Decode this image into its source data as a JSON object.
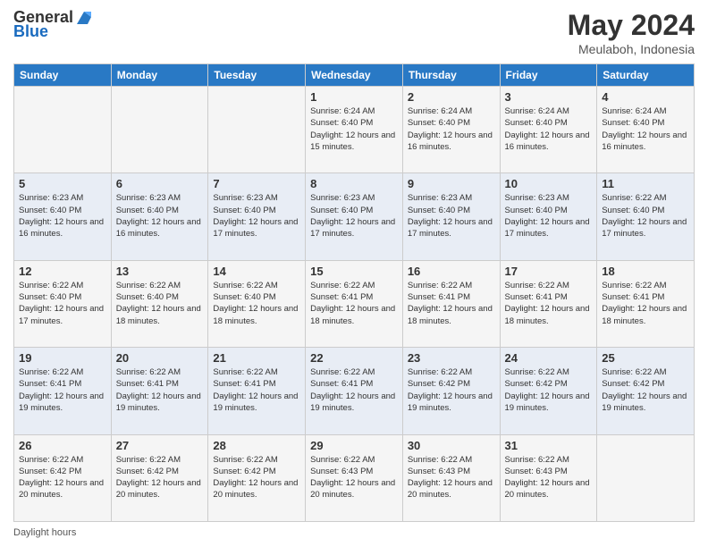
{
  "logo": {
    "general": "General",
    "blue": "Blue"
  },
  "title": "May 2024",
  "subtitle": "Meulaboh, Indonesia",
  "days_of_week": [
    "Sunday",
    "Monday",
    "Tuesday",
    "Wednesday",
    "Thursday",
    "Friday",
    "Saturday"
  ],
  "weeks": [
    [
      {
        "day": "",
        "info": ""
      },
      {
        "day": "",
        "info": ""
      },
      {
        "day": "",
        "info": ""
      },
      {
        "day": "1",
        "info": "Sunrise: 6:24 AM\nSunset: 6:40 PM\nDaylight: 12 hours\nand 15 minutes."
      },
      {
        "day": "2",
        "info": "Sunrise: 6:24 AM\nSunset: 6:40 PM\nDaylight: 12 hours\nand 16 minutes."
      },
      {
        "day": "3",
        "info": "Sunrise: 6:24 AM\nSunset: 6:40 PM\nDaylight: 12 hours\nand 16 minutes."
      },
      {
        "day": "4",
        "info": "Sunrise: 6:24 AM\nSunset: 6:40 PM\nDaylight: 12 hours\nand 16 minutes."
      }
    ],
    [
      {
        "day": "5",
        "info": "Sunrise: 6:23 AM\nSunset: 6:40 PM\nDaylight: 12 hours\nand 16 minutes."
      },
      {
        "day": "6",
        "info": "Sunrise: 6:23 AM\nSunset: 6:40 PM\nDaylight: 12 hours\nand 16 minutes."
      },
      {
        "day": "7",
        "info": "Sunrise: 6:23 AM\nSunset: 6:40 PM\nDaylight: 12 hours\nand 17 minutes."
      },
      {
        "day": "8",
        "info": "Sunrise: 6:23 AM\nSunset: 6:40 PM\nDaylight: 12 hours\nand 17 minutes."
      },
      {
        "day": "9",
        "info": "Sunrise: 6:23 AM\nSunset: 6:40 PM\nDaylight: 12 hours\nand 17 minutes."
      },
      {
        "day": "10",
        "info": "Sunrise: 6:23 AM\nSunset: 6:40 PM\nDaylight: 12 hours\nand 17 minutes."
      },
      {
        "day": "11",
        "info": "Sunrise: 6:22 AM\nSunset: 6:40 PM\nDaylight: 12 hours\nand 17 minutes."
      }
    ],
    [
      {
        "day": "12",
        "info": "Sunrise: 6:22 AM\nSunset: 6:40 PM\nDaylight: 12 hours\nand 17 minutes."
      },
      {
        "day": "13",
        "info": "Sunrise: 6:22 AM\nSunset: 6:40 PM\nDaylight: 12 hours\nand 18 minutes."
      },
      {
        "day": "14",
        "info": "Sunrise: 6:22 AM\nSunset: 6:40 PM\nDaylight: 12 hours\nand 18 minutes."
      },
      {
        "day": "15",
        "info": "Sunrise: 6:22 AM\nSunset: 6:41 PM\nDaylight: 12 hours\nand 18 minutes."
      },
      {
        "day": "16",
        "info": "Sunrise: 6:22 AM\nSunset: 6:41 PM\nDaylight: 12 hours\nand 18 minutes."
      },
      {
        "day": "17",
        "info": "Sunrise: 6:22 AM\nSunset: 6:41 PM\nDaylight: 12 hours\nand 18 minutes."
      },
      {
        "day": "18",
        "info": "Sunrise: 6:22 AM\nSunset: 6:41 PM\nDaylight: 12 hours\nand 18 minutes."
      }
    ],
    [
      {
        "day": "19",
        "info": "Sunrise: 6:22 AM\nSunset: 6:41 PM\nDaylight: 12 hours\nand 19 minutes."
      },
      {
        "day": "20",
        "info": "Sunrise: 6:22 AM\nSunset: 6:41 PM\nDaylight: 12 hours\nand 19 minutes."
      },
      {
        "day": "21",
        "info": "Sunrise: 6:22 AM\nSunset: 6:41 PM\nDaylight: 12 hours\nand 19 minutes."
      },
      {
        "day": "22",
        "info": "Sunrise: 6:22 AM\nSunset: 6:41 PM\nDaylight: 12 hours\nand 19 minutes."
      },
      {
        "day": "23",
        "info": "Sunrise: 6:22 AM\nSunset: 6:42 PM\nDaylight: 12 hours\nand 19 minutes."
      },
      {
        "day": "24",
        "info": "Sunrise: 6:22 AM\nSunset: 6:42 PM\nDaylight: 12 hours\nand 19 minutes."
      },
      {
        "day": "25",
        "info": "Sunrise: 6:22 AM\nSunset: 6:42 PM\nDaylight: 12 hours\nand 19 minutes."
      }
    ],
    [
      {
        "day": "26",
        "info": "Sunrise: 6:22 AM\nSunset: 6:42 PM\nDaylight: 12 hours\nand 20 minutes."
      },
      {
        "day": "27",
        "info": "Sunrise: 6:22 AM\nSunset: 6:42 PM\nDaylight: 12 hours\nand 20 minutes."
      },
      {
        "day": "28",
        "info": "Sunrise: 6:22 AM\nSunset: 6:42 PM\nDaylight: 12 hours\nand 20 minutes."
      },
      {
        "day": "29",
        "info": "Sunrise: 6:22 AM\nSunset: 6:43 PM\nDaylight: 12 hours\nand 20 minutes."
      },
      {
        "day": "30",
        "info": "Sunrise: 6:22 AM\nSunset: 6:43 PM\nDaylight: 12 hours\nand 20 minutes."
      },
      {
        "day": "31",
        "info": "Sunrise: 6:22 AM\nSunset: 6:43 PM\nDaylight: 12 hours\nand 20 minutes."
      },
      {
        "day": "",
        "info": ""
      }
    ]
  ],
  "footer": {
    "daylight_label": "Daylight hours"
  }
}
